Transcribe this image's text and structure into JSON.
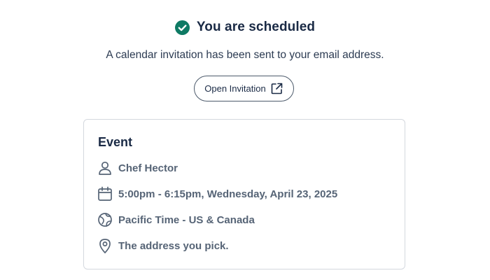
{
  "confirmation": {
    "title": "You are scheduled",
    "subtitle": "A calendar invitation has been sent to your email address.",
    "open_invitation_label": "Open Invitation"
  },
  "event_card": {
    "title": "Event",
    "host": "Chef Hector",
    "datetime": "5:00pm - 6:15pm, Wednesday, April 23, 2025",
    "timezone": "Pacific Time - US & Canada",
    "location": "The address you pick."
  },
  "icons": {
    "success": "check-circle-icon",
    "external": "external-link-icon",
    "host": "person-icon",
    "datetime": "calendar-icon",
    "timezone": "globe-icon",
    "location": "map-pin-icon"
  },
  "colors": {
    "success": "#0e7a64",
    "heading": "#1a2a45",
    "detail_text": "#566476",
    "card_border": "#d4d8de"
  }
}
